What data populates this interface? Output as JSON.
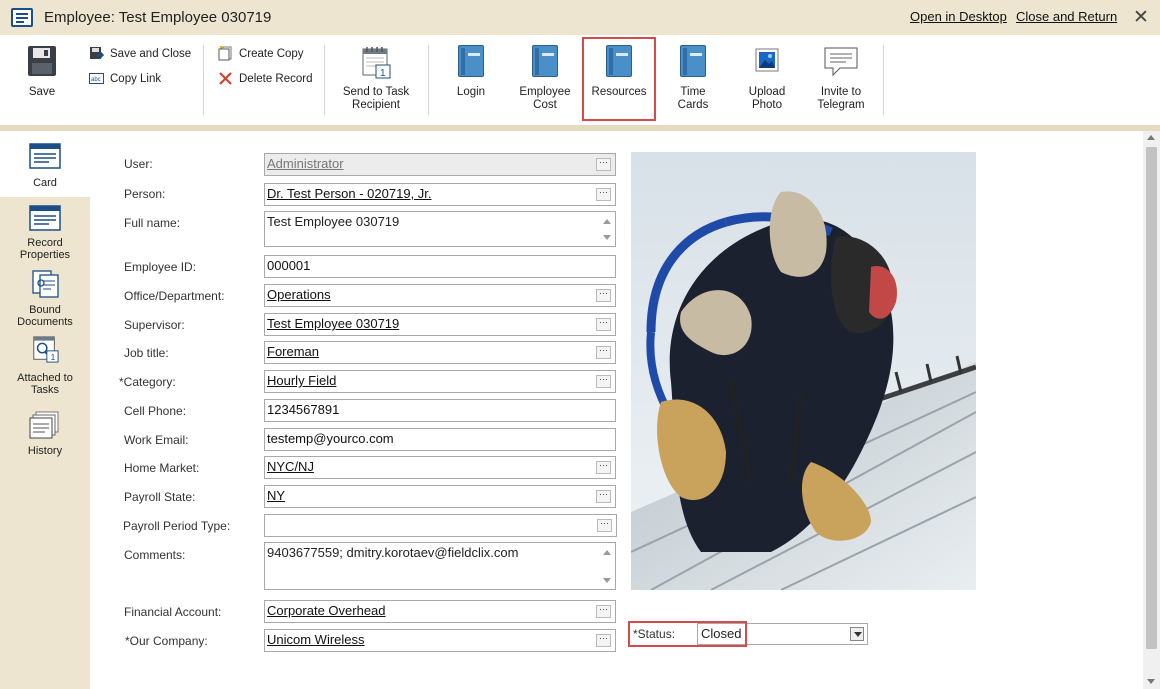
{
  "window": {
    "title": "Employee: Test Employee 030719",
    "open_in_desktop": "Open in Desktop",
    "close_and_return": "Close and Return",
    "close_glyph": "✕"
  },
  "toolbar": {
    "save": "Save",
    "save_and_close": "Save and Close",
    "copy_link": "Copy Link",
    "create_copy": "Create Copy",
    "delete_record": "Delete Record",
    "send_to_task_line1": "Send to Task",
    "send_to_task_line2": "Recipient",
    "login": "Login",
    "employee_cost_line1": "Employee",
    "employee_cost_line2": "Cost",
    "resources": "Resources",
    "time_cards_line1": "Time",
    "time_cards_line2": "Cards",
    "upload_photo_line1": "Upload",
    "upload_photo_line2": "Photo",
    "invite_telegram_line1": "Invite to",
    "invite_telegram_line2": "Telegram"
  },
  "leftnav": {
    "card": "Card",
    "record_properties_line1": "Record",
    "record_properties_line2": "Properties",
    "bound_documents_line1": "Bound",
    "bound_documents_line2": "Documents",
    "attached_tasks_line1": "Attached to",
    "attached_tasks_line2": "Tasks",
    "history": "History"
  },
  "form": {
    "user": {
      "label": "User:",
      "value": "Administrator"
    },
    "person": {
      "label": "Person:",
      "value": "Dr. Test Person - 020719, Jr."
    },
    "full_name": {
      "label": "Full name:",
      "value": "Test Employee 030719"
    },
    "employee_id": {
      "label": "Employee ID:",
      "value": "000001"
    },
    "office": {
      "label": "Office/Department:",
      "value": "Operations"
    },
    "supervisor": {
      "label": "Supervisor:",
      "value": "Test Employee 030719"
    },
    "job_title": {
      "label": "Job title:",
      "value": "Foreman"
    },
    "category": {
      "label": "*Category:",
      "value": "Hourly Field"
    },
    "cell_phone": {
      "label": "Cell Phone:",
      "value": "1234567891"
    },
    "work_email": {
      "label": "Work Email:",
      "value": "testemp@yourco.com"
    },
    "home_market": {
      "label": "Home Market:",
      "value": "NYC/NJ"
    },
    "payroll_state": {
      "label": "Payroll State:",
      "value": "NY"
    },
    "payroll_period_type": {
      "label": "Payroll Period Type:",
      "value": ""
    },
    "comments": {
      "label": "Comments:",
      "value": "9403677559; dmitry.korotaev@fieldclix.com"
    },
    "financial_account": {
      "label": "Financial Account:",
      "value": "Corporate Overhead"
    },
    "our_company": {
      "label": "*Our Company:",
      "value": "Unicom Wireless"
    },
    "status": {
      "label": "*Status:",
      "value": "Closed"
    }
  },
  "colors": {
    "beige": "#ede5cf",
    "highlight": "#d84a4a",
    "accent_blue": "#1b4f86"
  }
}
